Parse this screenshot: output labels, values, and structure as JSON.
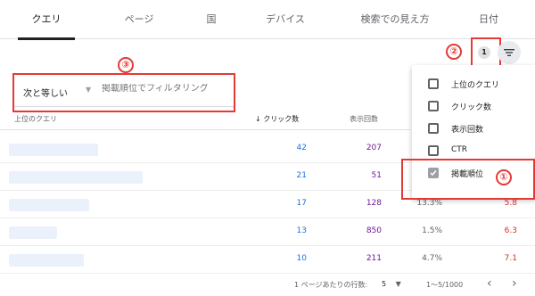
{
  "tabs": [
    "クエリ",
    "ページ",
    "国",
    "デバイス",
    "検索での見え方",
    "日付"
  ],
  "active_tab": "クエリ",
  "filter_count": "1",
  "annotations": {
    "one": "①",
    "two": "②",
    "three": "③"
  },
  "filter": {
    "operator": "次と等しい",
    "placeholder": "掲載順位でフィルタリング"
  },
  "table": {
    "headers": {
      "query": "上位のクエリ",
      "clicks": "クリック数",
      "impressions": "表示回数"
    },
    "rows": [
      {
        "clicks": "42",
        "impressions": "207",
        "ctr": "",
        "position": ""
      },
      {
        "clicks": "21",
        "impressions": "51",
        "ctr": "",
        "position": ""
      },
      {
        "clicks": "17",
        "impressions": "128",
        "ctr": "13.3%",
        "position": "5.8"
      },
      {
        "clicks": "13",
        "impressions": "850",
        "ctr": "1.5%",
        "position": "6.3"
      },
      {
        "clicks": "10",
        "impressions": "211",
        "ctr": "4.7%",
        "position": "7.1"
      }
    ]
  },
  "menu": {
    "items": [
      {
        "label": "上位のクエリ",
        "checked": false
      },
      {
        "label": "クリック数",
        "checked": false
      },
      {
        "label": "表示回数",
        "checked": false
      },
      {
        "label": "CTR",
        "checked": false
      },
      {
        "label": "掲載順位",
        "checked": true
      }
    ]
  },
  "pagination": {
    "rows_per_page_label": "1 ページあたりの行数:",
    "rows_per_page": "5",
    "range": "1〜5/1000",
    "prev": "‹",
    "next": "›"
  },
  "colors": {
    "annotation": "#e53935",
    "clicks": "#1a73e8",
    "impressions": "#6a1b9a",
    "position": "#d93025"
  }
}
